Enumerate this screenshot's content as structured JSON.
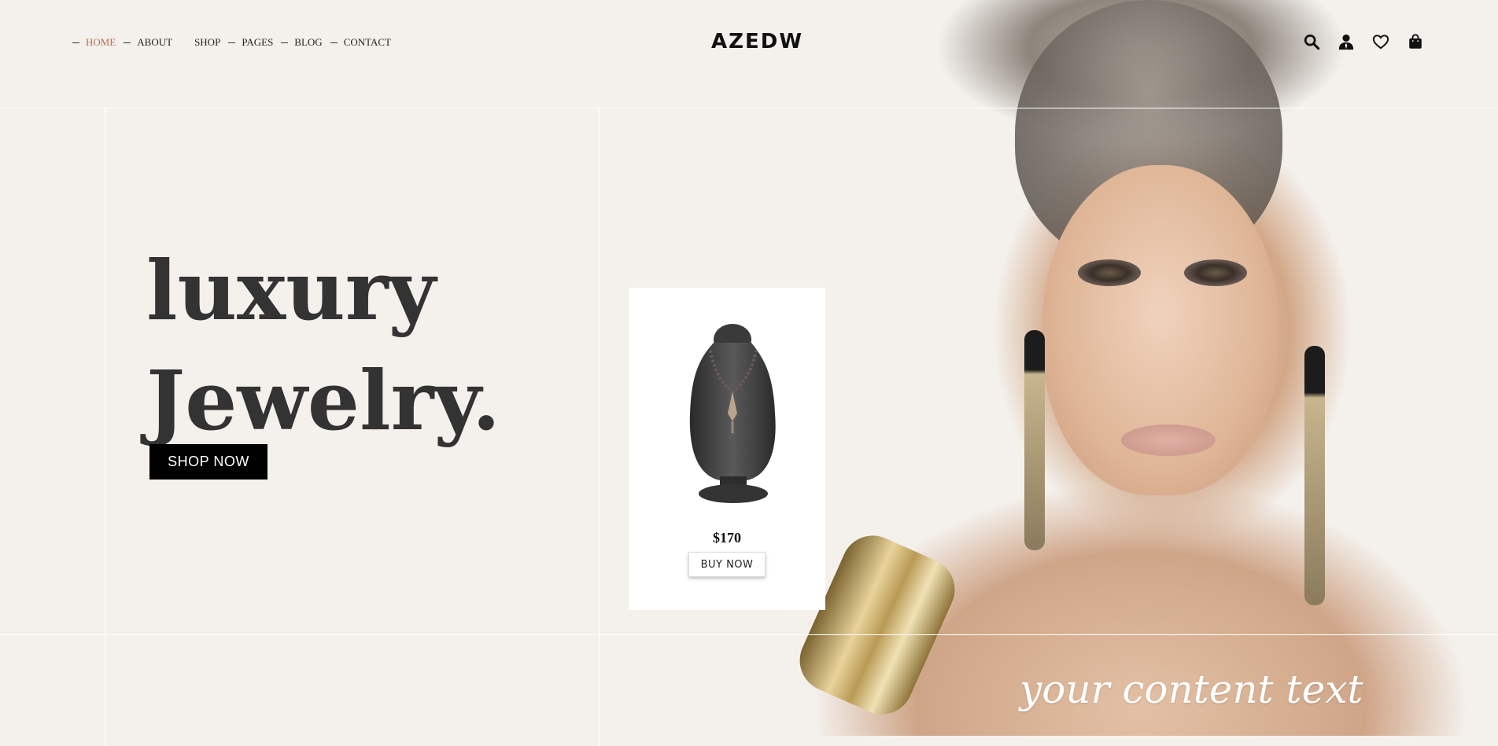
{
  "nav": {
    "items": [
      {
        "label": "HOME",
        "active": true
      },
      {
        "label": "ABOUT",
        "active": false
      },
      {
        "label": "SHOP",
        "active": false
      },
      {
        "label": "PAGES",
        "active": false
      },
      {
        "label": "BLOG",
        "active": false
      },
      {
        "label": "CONTACT",
        "active": false
      }
    ]
  },
  "logo": "AZEDW",
  "header_icons": [
    "search-icon",
    "user-icon",
    "heart-icon",
    "bag-icon"
  ],
  "hero": {
    "line1": "luxury",
    "line2": "Jewelry.",
    "cta": "SHOP NOW",
    "overlay_text": "your content text"
  },
  "product": {
    "price": "$170",
    "buy_label": "BUY NOW"
  },
  "colors": {
    "background": "#f4f1ed",
    "accent_active_nav": "#b86b4b",
    "button": "#000000"
  }
}
